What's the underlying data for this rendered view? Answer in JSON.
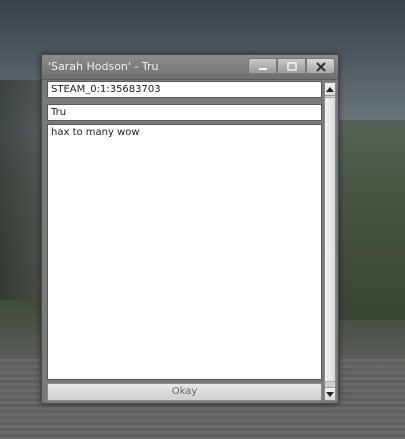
{
  "window": {
    "title": "'Sarah Hodson' - Tru"
  },
  "titlebar_buttons": {
    "minimize": "minimize-icon",
    "maximize": "maximize-icon",
    "close": "close-icon"
  },
  "form": {
    "steam_id": "STEAM_0:1:35683703",
    "reason": "Tru",
    "message": "hax to many wow",
    "okay_label": "Okay"
  },
  "scrollbar": {
    "up": "arrow-up-icon",
    "down": "arrow-down-icon"
  }
}
